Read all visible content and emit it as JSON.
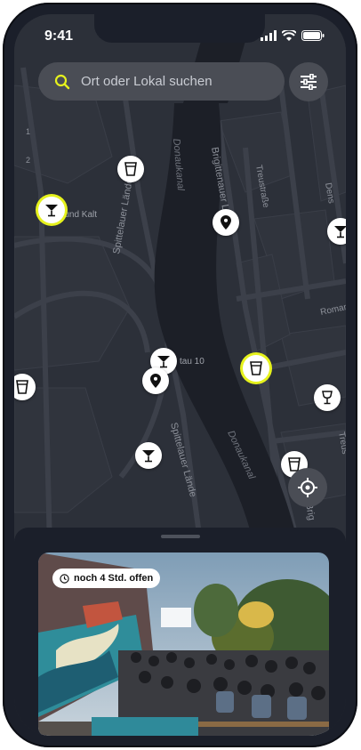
{
  "status": {
    "time": "9:41"
  },
  "search": {
    "placeholder": "Ort oder Lokal suchen"
  },
  "map": {
    "labels": {
      "street_spittelauer_1": "Spittelauer Lände",
      "street_spittelauer_2": "Spittelauer Lände",
      "canal_1": "Donaukanal",
      "canal_2": "Donaukanal",
      "street_brigittenauer": "Brigittenauer Lände",
      "street_treustrasse_1": "Treustraße",
      "street_treustrasse_2": "Treus",
      "street_dens": "Dens",
      "street_roman": "Roman",
      "street_brig": "Brig",
      "place_1": "0 und Kalt",
      "place_2": "tau 10",
      "numbers": [
        "1",
        "2"
      ]
    }
  },
  "sheet": {
    "badge_text": "noch 4 Std. offen"
  },
  "colors": {
    "accent": "#e6f21d",
    "surface": "#1b1f2a",
    "map_bg": "#2b2f38",
    "control_bg": "#4a4d55"
  }
}
